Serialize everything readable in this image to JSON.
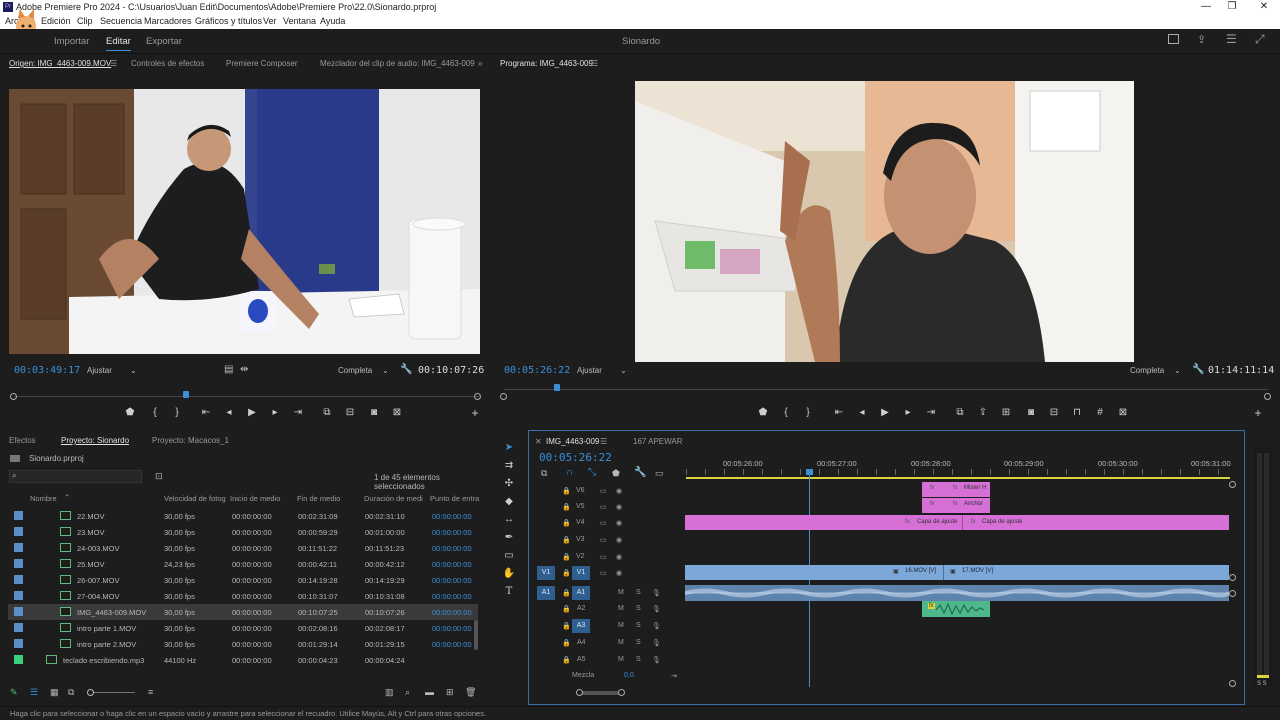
{
  "app": {
    "title": "Adobe Premiere Pro 2024 - C:\\Usuarios\\Juan Edit\\Documentos\\Adobe\\Premiere Pro\\22.0\\Sionardo.prproj",
    "menus": [
      "Archivo",
      "Edición",
      "Clip",
      "Secuencia",
      "Marcadores",
      "Gráficos y títulos",
      "Ver",
      "Ventana",
      "Ayuda"
    ],
    "workspace_tabs": [
      "Importar",
      "Editar",
      "Exportar"
    ],
    "project_name": "Sionardo",
    "status_bar": "Haga clic para seleccionar o haga clic en un espacio vacío y arrastre para seleccionar el recuadro. Utilice Mayús, Alt y Ctrl para otras opciones."
  },
  "source_panel": {
    "tabs": [
      "Origen: IMG_4463-009.MOV",
      "Controles de efectos",
      "Premiere Composer",
      "Mezclador del clip de audio: IMG_4463-009"
    ],
    "timecode": "00:03:49:17",
    "fit": "Ajustar",
    "resolution": "Completa",
    "duration": "00:10:07:26",
    "playhead_fraction": 0.37
  },
  "program_panel": {
    "tab": "Programa: IMG_4463-009",
    "timecode": "00:05:26:22",
    "fit": "Ajustar",
    "resolution": "Completa",
    "duration": "01:14:11:14",
    "playhead_fraction": 0.07
  },
  "project_panel": {
    "tabs": [
      "Efectos",
      "Proyecto: Sionardo",
      "Proyecto: Macacos_1"
    ],
    "file": "Sionardo.prproj",
    "count": "1 de 45 elementos seleccionados",
    "columns": [
      "Nombre",
      "Velocidad de fotog",
      "Inicio de medio",
      "Fin de medio",
      "Duración de medi",
      "Punto de entra"
    ],
    "rows": [
      {
        "name": "22.MOV",
        "fps": "30,00 fps",
        "start": "00:00:00:00",
        "end": "00:02:31:09",
        "dur": "00:02:31:10",
        "in": "00:00:00:00",
        "color": "#5a8fc7",
        "selected": false
      },
      {
        "name": "23.MOV",
        "fps": "30,00 fps",
        "start": "00:00:00:00",
        "end": "00:00:59:29",
        "dur": "00:01:00:00",
        "in": "00:00:00:00",
        "color": "#5a8fc7",
        "selected": false
      },
      {
        "name": "24-003.MOV",
        "fps": "30,00 fps",
        "start": "00:00:00:00",
        "end": "00:11:51:22",
        "dur": "00:11:51:23",
        "in": "00:00:00:00",
        "color": "#5a8fc7",
        "selected": false
      },
      {
        "name": "25.MOV",
        "fps": "24,23 fps",
        "start": "00:00:00:00",
        "end": "00:00:42:11",
        "dur": "00:00:42:12",
        "in": "00:00:00:00",
        "color": "#5a8fc7",
        "selected": false
      },
      {
        "name": "26-007.MOV",
        "fps": "30,00 fps",
        "start": "00:00:00:00",
        "end": "00:14:19:28",
        "dur": "00:14:19:29",
        "in": "00:00:00:00",
        "color": "#5a8fc7",
        "selected": false
      },
      {
        "name": "27-004.MOV",
        "fps": "30,00 fps",
        "start": "00:00:00:00",
        "end": "00:10:31:07",
        "dur": "00:10:31:08",
        "in": "00:00:00:00",
        "color": "#5a8fc7",
        "selected": false
      },
      {
        "name": "IMG_4463-009.MOV",
        "fps": "30,00 fps",
        "start": "00:00:00:00",
        "end": "00:10:07:25",
        "dur": "00:10:07:26",
        "in": "00:00:00:00",
        "color": "#5a8fc7",
        "selected": true
      },
      {
        "name": "intro parte 1.MOV",
        "fps": "30,00 fps",
        "start": "00:00:00:00",
        "end": "00:02:08:16",
        "dur": "00:02:08:17",
        "in": "00:00:00:00",
        "color": "#5a8fc7",
        "selected": false
      },
      {
        "name": "intro parte 2.MOV",
        "fps": "30,00 fps",
        "start": "00:00:00:00",
        "end": "00:01:29:14",
        "dur": "00:01:29:15",
        "in": "00:00:00:00",
        "color": "#5a8fc7",
        "selected": false
      },
      {
        "name": "teclado escribiendo.mp3",
        "fps": "44100 Hz",
        "start": "00:00:00:00",
        "end": "00:00:04:23",
        "dur": "00:00:04:24",
        "in": "",
        "color": "#3dcf7a",
        "selected": false
      }
    ]
  },
  "timeline": {
    "tabs": [
      "IMG_4463-009",
      "167 APEWAR"
    ],
    "timecode": "00:05:26:22",
    "ruler": [
      "00:05:26:00",
      "00:05:27:00",
      "00:05:28:00",
      "00:05:29:00",
      "00:05:30:00",
      "00:05:31:00"
    ],
    "video_tracks": [
      "V6",
      "V5",
      "V4",
      "V3",
      "V2",
      "V1"
    ],
    "audio_tracks": [
      "A1",
      "A2",
      "A3",
      "A4",
      "A5"
    ],
    "mix_label": "Mezcla",
    "mix_value": "0,0",
    "clips": {
      "v6": "Mister H",
      "v5": "Anchor",
      "v4a": "Capa de ajuste",
      "v4b": "Capa de ajuste",
      "v1a": "16.MOV [V]",
      "v1b": "17.MOV [V]"
    }
  },
  "colors": {
    "accent": "#3b8fd6",
    "adjustment_clip": "#d66fd6",
    "video_clip": "#7ba8d8",
    "audio_clip": "#4fb88b"
  }
}
